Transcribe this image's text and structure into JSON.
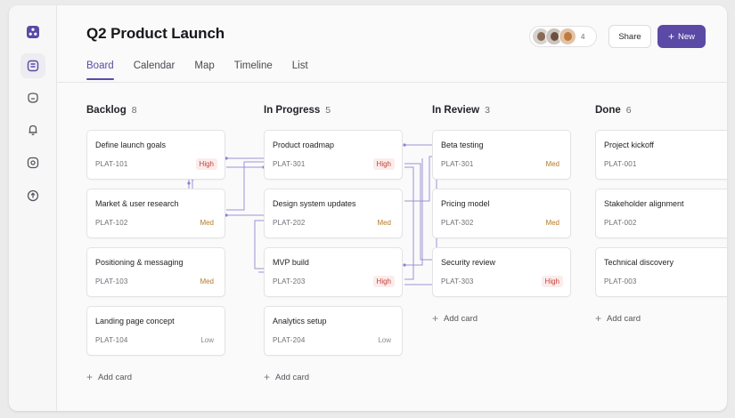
{
  "app": {
    "title": "Q2 Product Launch",
    "accent": "#5b49a6"
  },
  "rail": {
    "items": [
      {
        "icon": "workspace-logo-icon"
      },
      {
        "icon": "board-icon",
        "active": true
      },
      {
        "icon": "inbox-icon"
      },
      {
        "icon": "notifications-icon"
      },
      {
        "icon": "settings-icon"
      },
      {
        "icon": "upload-icon"
      }
    ]
  },
  "tabs": [
    "Board",
    "Calendar",
    "Map",
    "Timeline",
    "List"
  ],
  "header": {
    "avatar_count": "4",
    "share_label": "Share",
    "new_label": "New"
  },
  "columns": [
    {
      "name": "Backlog",
      "count": "8",
      "cards": [
        {
          "title": "Define launch goals",
          "id": "PLAT-101",
          "priority": "High"
        },
        {
          "title": "Market & user research",
          "id": "PLAT-102",
          "priority": "Med"
        },
        {
          "title": "Positioning & messaging",
          "id": "PLAT-103",
          "priority": "Med"
        },
        {
          "title": "Landing page concept",
          "id": "PLAT-104",
          "priority": "Low"
        }
      ],
      "add_label": "Add card"
    },
    {
      "name": "In Progress",
      "count": "5",
      "cards": [
        {
          "title": "Product roadmap",
          "id": "PLAT-301",
          "priority": "High"
        },
        {
          "title": "Design system updates",
          "id": "PLAT-202",
          "priority": "Med"
        },
        {
          "title": "MVP build",
          "id": "PLAT-203",
          "priority": "High"
        },
        {
          "title": "Analytics setup",
          "id": "PLAT-204",
          "priority": "Low"
        }
      ],
      "add_label": "Add card"
    },
    {
      "name": "In Review",
      "count": "3",
      "cards": [
        {
          "title": "Beta testing",
          "id": "PLAT-301",
          "priority": "Med"
        },
        {
          "title": "Pricing model",
          "id": "PLAT-302",
          "priority": "Med"
        },
        {
          "title": "Security review",
          "id": "PLAT-303",
          "priority": "High"
        }
      ],
      "add_label": "Add card"
    },
    {
      "name": "Done",
      "count": "6",
      "cards": [
        {
          "title": "Project kickoff",
          "id": "PLAT-001",
          "priority": ""
        },
        {
          "title": "Stakeholder alignment",
          "id": "PLAT-002",
          "priority": ""
        },
        {
          "title": "Technical discovery",
          "id": "PLAT-003",
          "priority": ""
        }
      ],
      "add_label": "Add card"
    }
  ],
  "colors": {
    "high": "#c6423a",
    "med": "#b57a2a",
    "low": "#8a8a92",
    "connector": "#8f7fcf"
  }
}
